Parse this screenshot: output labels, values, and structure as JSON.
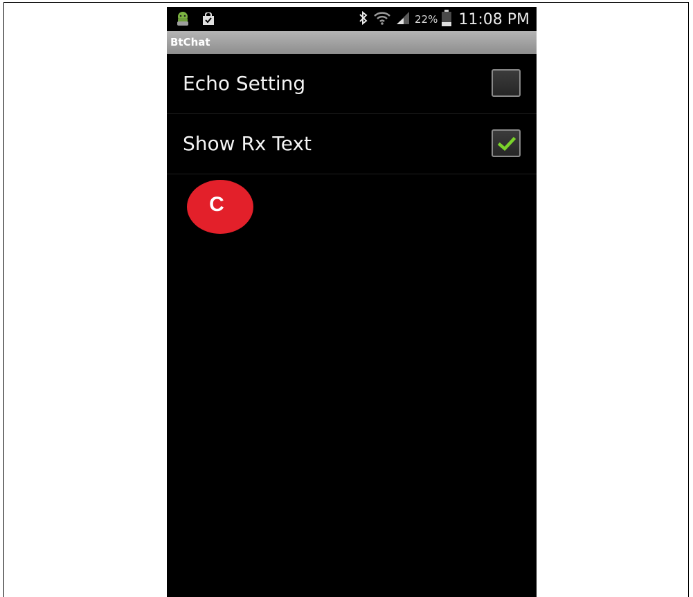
{
  "status_bar": {
    "battery_text": "22%",
    "time": "11:08 PM",
    "icons": [
      "android-icon",
      "shopping-bag-icon",
      "bluetooth-icon",
      "wifi-icon",
      "signal-icon",
      "battery-icon"
    ]
  },
  "app": {
    "title": "BtChat"
  },
  "settings": [
    {
      "label": "Echo Setting",
      "checked": false
    },
    {
      "label": "Show Rx Text",
      "checked": true
    }
  ],
  "marker": {
    "label": "C",
    "color": "#e3202a"
  },
  "colors": {
    "check": "#7ad32a",
    "title_bar": "#9e9e9e"
  }
}
